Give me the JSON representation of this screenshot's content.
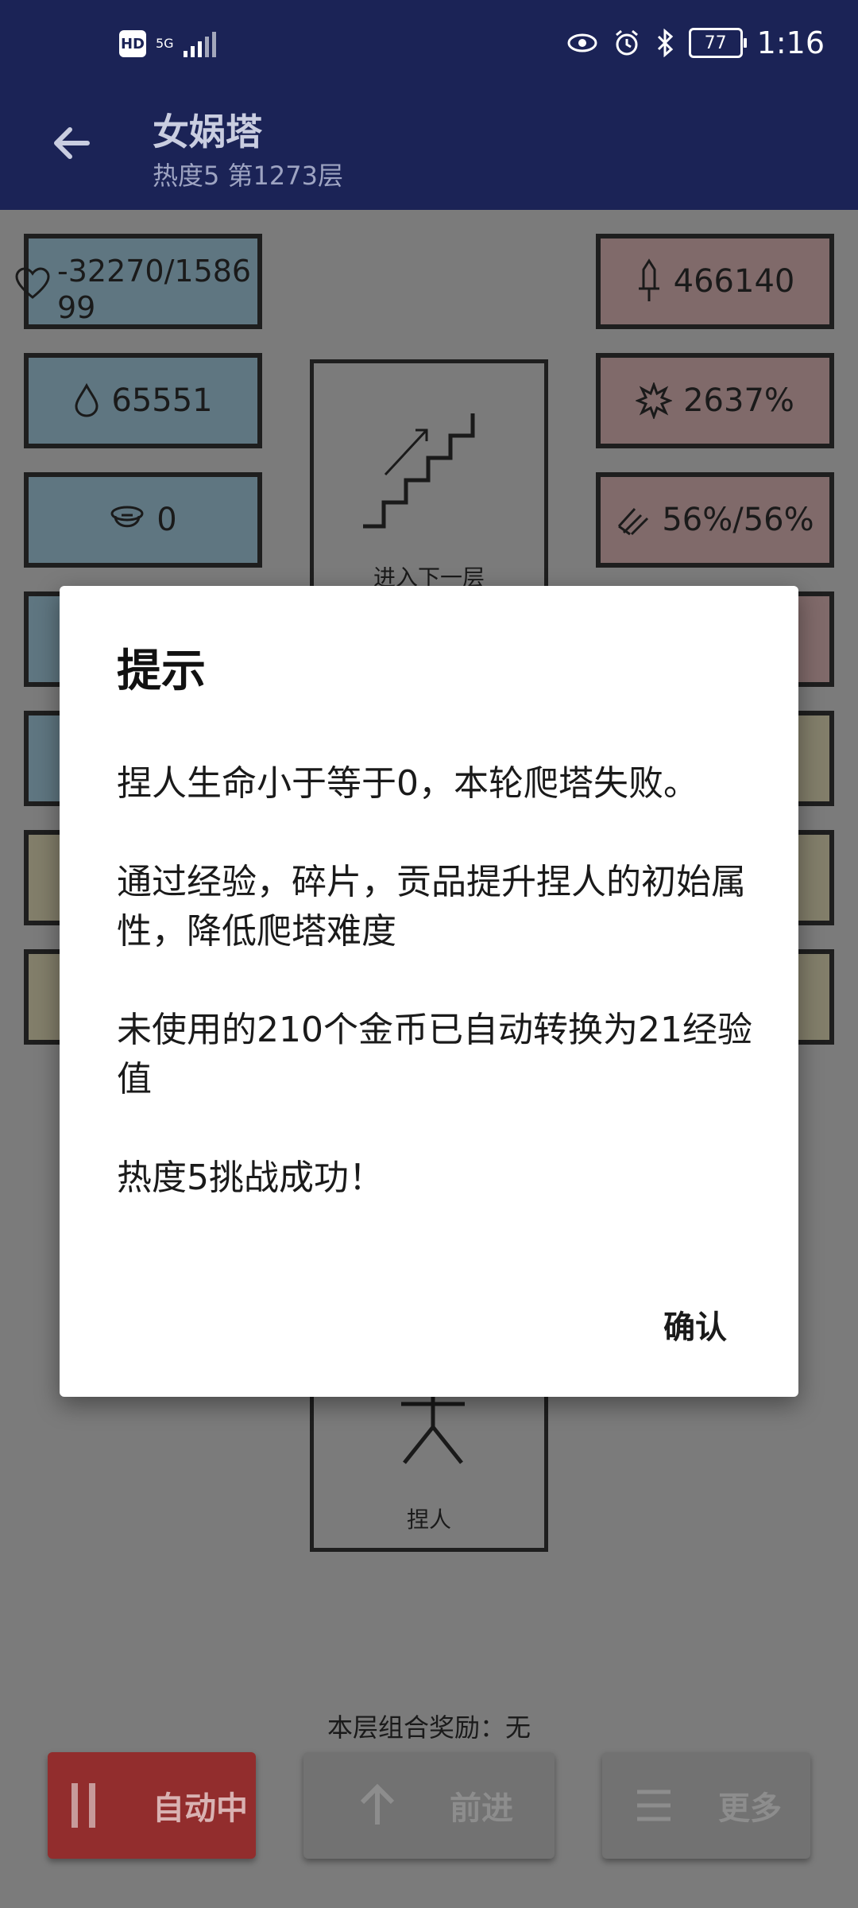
{
  "status_bar": {
    "hd": "HD",
    "network": "5G",
    "time": "1:16",
    "battery": "77"
  },
  "app_bar": {
    "title": "女娲塔",
    "subtitle": "热度5 第1273层"
  },
  "left_stats": [
    {
      "icon": "heart-icon",
      "value": "-32270/158699"
    },
    {
      "icon": "drop-icon",
      "value": "65551"
    },
    {
      "icon": "helmet-icon",
      "value": "0"
    }
  ],
  "right_stats": [
    {
      "icon": "sword-icon",
      "value": "466140"
    },
    {
      "icon": "burst-icon",
      "value": "2637%"
    },
    {
      "icon": "slash-icon",
      "value": "56%/56%"
    }
  ],
  "center": {
    "stairs_label": "进入下一层",
    "person_label": "捏人"
  },
  "reward_line": "本层组合奖励：无",
  "buttons": {
    "auto": "自动中",
    "forward": "前进",
    "more": "更多"
  },
  "dialog": {
    "title": "提示",
    "message": "捏人生命小于等于0，本轮爬塔失败。\n\n通过经验，碎片，贡品提升捏人的初始属性，降低爬塔难度\n\n未使用的210个金币已自动转换为21经验值\n\n热度5挑战成功！",
    "confirm": "确认"
  },
  "colors": {
    "app_bar": "#1b2356",
    "auto_button": "#922d2d",
    "dialog_bg": "#ffffff"
  }
}
